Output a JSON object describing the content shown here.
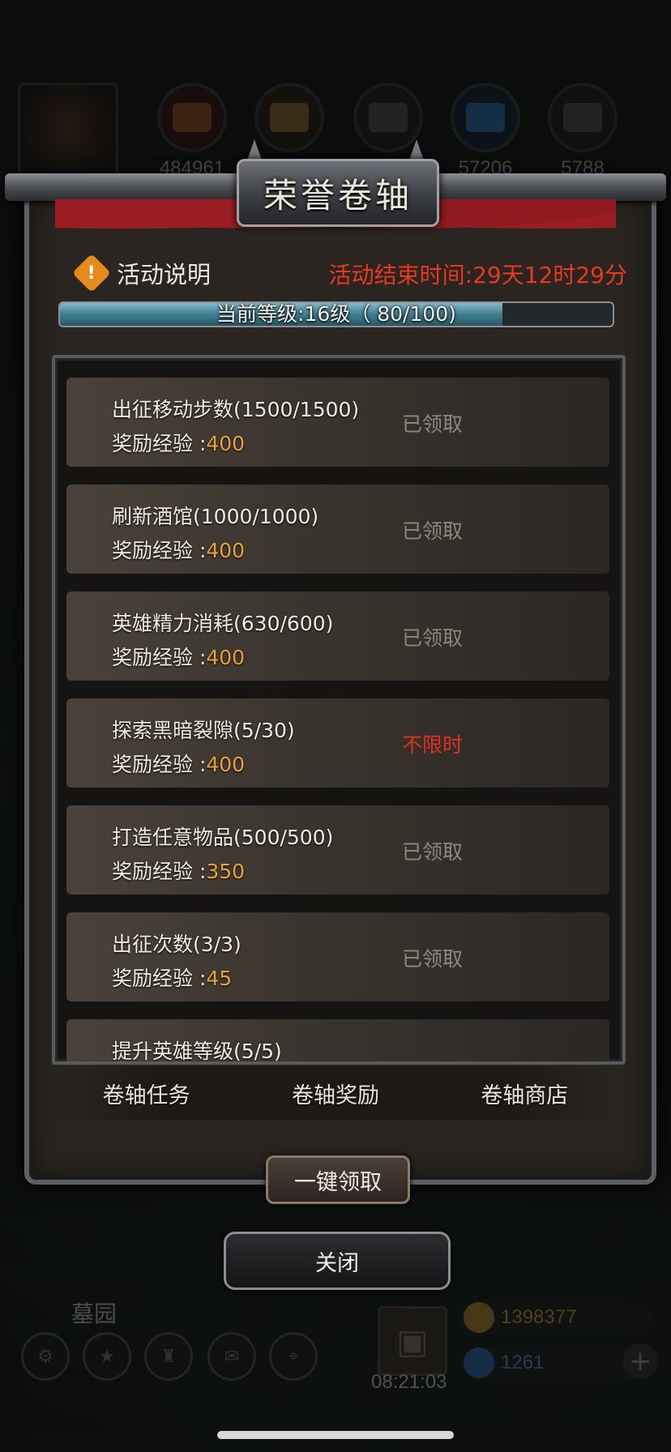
{
  "hud": {
    "resources": [
      {
        "icon": "wood-icon",
        "value": "484961"
      },
      {
        "icon": "lumber-icon",
        "value": ""
      },
      {
        "icon": "iron-icon",
        "value": ""
      },
      {
        "icon": "crystal-icon",
        "value": "57206"
      },
      {
        "icon": "stone-icon",
        "value": "5788"
      }
    ],
    "place_name": "墓园",
    "gift_timer": "08:21:03",
    "gold": "1398377",
    "gems": "1261",
    "plus": "+"
  },
  "modal": {
    "title": "荣誉卷轴",
    "info_label": "活动说明",
    "warn_glyph": "!",
    "end_time": "活动结束时间:29天12时29分",
    "level_text": "当前等级:16级（ 80/100)",
    "level_progress": 0.8,
    "reward_label": "奖励经验 :",
    "tasks": [
      {
        "name": "出征移动步数(1500/1500)",
        "xp": "400",
        "status": "已领取",
        "status_type": "claimed"
      },
      {
        "name": "刷新酒馆(1000/1000)",
        "xp": "400",
        "status": "已领取",
        "status_type": "claimed"
      },
      {
        "name": "英雄精力消耗(630/600)",
        "xp": "400",
        "status": "已领取",
        "status_type": "claimed"
      },
      {
        "name": "探索黑暗裂隙(5/30)",
        "xp": "400",
        "status": "不限时",
        "status_type": "unlimited"
      },
      {
        "name": "打造任意物品(500/500)",
        "xp": "350",
        "status": "已领取",
        "status_type": "claimed"
      },
      {
        "name": "出征次数(3/3)",
        "xp": "45",
        "status": "已领取",
        "status_type": "claimed"
      }
    ],
    "partial_task": "提升英雄等级(5/5)",
    "tabs": [
      "卷轴任务",
      "卷轴奖励",
      "卷轴商店"
    ],
    "claim_all": "一键领取",
    "close": "关闭"
  },
  "colors": {
    "accent_red": "#e8391e",
    "xp_orange": "#e6a23a",
    "claimed_gray": "#8c8780"
  }
}
